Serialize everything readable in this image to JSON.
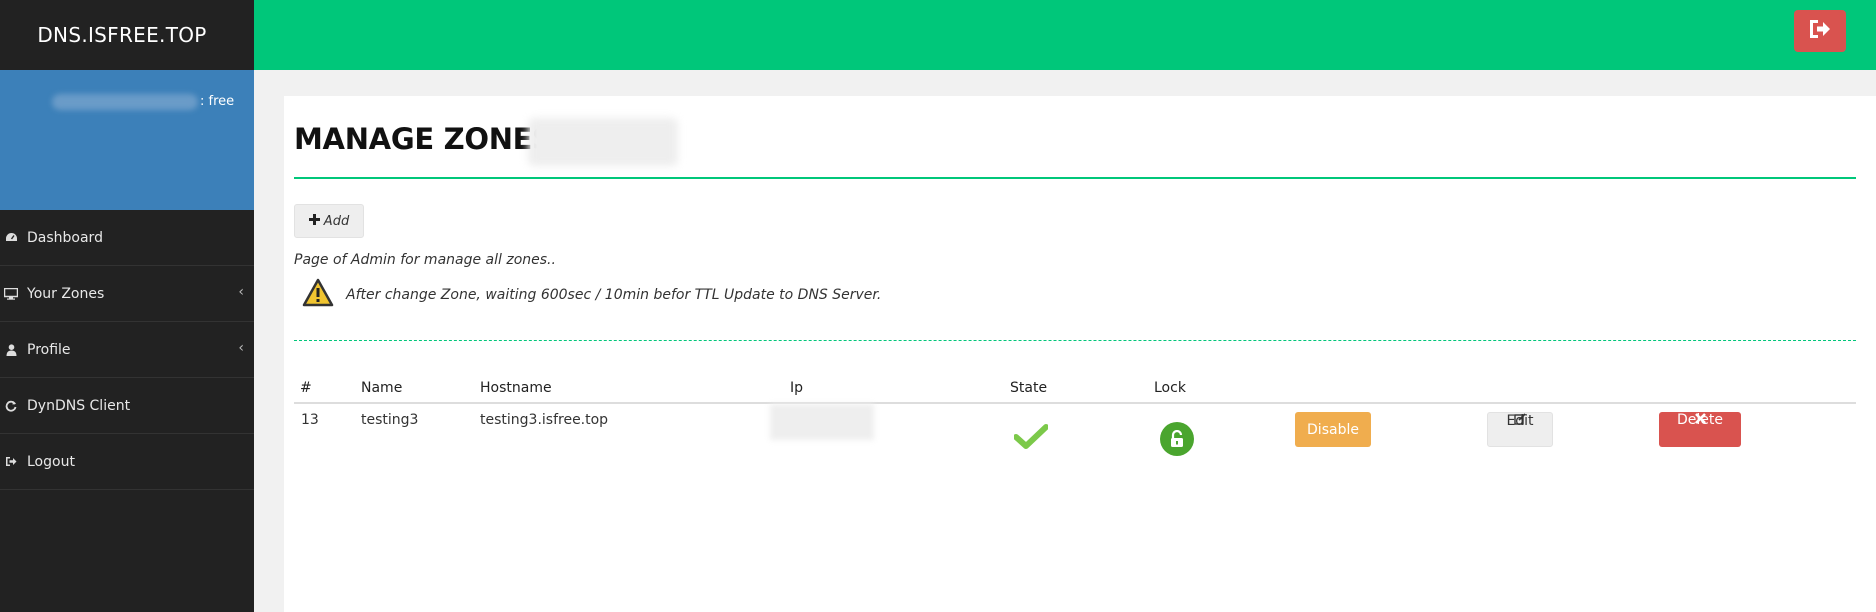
{
  "app": {
    "brand": "DNS.ISFREE.TOP"
  },
  "user_panel": {
    "plan": ": free"
  },
  "sidebar": {
    "items": [
      {
        "label": "Dashboard",
        "icon": "dashboard-icon",
        "has_submenu": false
      },
      {
        "label": "Your Zones",
        "icon": "desktop-icon",
        "has_submenu": true
      },
      {
        "label": "Profile",
        "icon": "user-icon",
        "has_submenu": true
      },
      {
        "label": "DynDNS Client",
        "icon": "sync-icon",
        "has_submenu": false
      },
      {
        "label": "Logout",
        "icon": "sign-out-icon",
        "has_submenu": false
      }
    ]
  },
  "page": {
    "title": "MANAGE ZONES",
    "add_label": "Add",
    "description": "Page of Admin for manage all zones..",
    "warning": "After change Zone, waiting 600sec / 10min befor TTL Update to DNS Server."
  },
  "table": {
    "headers": [
      "#",
      "Name",
      "Hostname",
      "Ip",
      "State",
      "Lock"
    ],
    "rows": [
      {
        "id": "13",
        "name": "testing3",
        "hostname": "testing3.isfree.top",
        "ip": "",
        "state": "active",
        "lock": "unlocked",
        "disable_label": "Disable",
        "edit_label": "Edit",
        "delete_label": "Delete"
      }
    ]
  },
  "colors": {
    "topbar": "#00c77a",
    "sidebar": "#222222",
    "user_panel": "#3c80b9",
    "danger": "#d9534f",
    "warning": "#f0ad4e",
    "success": "#4aa52e"
  }
}
